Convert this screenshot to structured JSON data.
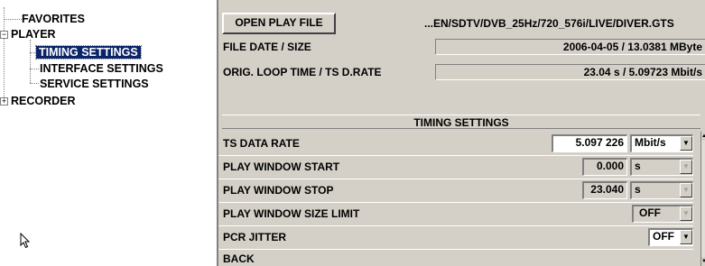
{
  "tree": {
    "items": [
      {
        "label": "FAVORITES"
      },
      {
        "label": "PLAYER",
        "expander": "−"
      },
      {
        "label": "TIMING SETTINGS"
      },
      {
        "label": "INTERFACE SETTINGS"
      },
      {
        "label": "SERVICE SETTINGS"
      },
      {
        "label": "RECORDER",
        "expander": "+"
      }
    ]
  },
  "file_info": {
    "open_button": "OPEN PLAY FILE",
    "path": "...EN/SDTV/DVB_25Hz/720_576i/LIVE/DIVER.GTS",
    "date_size_label": "FILE DATE / SIZE",
    "date_size_value": "2006-04-05  /  13.0381 MByte",
    "loop_label": "ORIG. LOOP TIME / TS D.RATE",
    "loop_value": "23.04 s / 5.09723 Mbit/s"
  },
  "section": {
    "title": "TIMING SETTINGS"
  },
  "settings": {
    "ts_rate": {
      "label": "TS DATA RATE",
      "value": "5.097 226",
      "unit": "Mbit/s"
    },
    "window_start": {
      "label": "PLAY WINDOW START",
      "value": "0.000",
      "unit": "s"
    },
    "window_stop": {
      "label": "PLAY WINDOW STOP",
      "value": "23.040",
      "unit": "s"
    },
    "size_limit": {
      "label": "PLAY WINDOW SIZE LIMIT",
      "value": "OFF"
    },
    "pcr_jitter": {
      "label": "PCR JITTER",
      "value": "OFF"
    },
    "back": {
      "label": "BACK"
    }
  },
  "icons": {
    "dropdown": "▼",
    "scroll_up": "▲",
    "scroll_down": "▼"
  },
  "colors": {
    "panel_bg": "#d4d0c8",
    "selection_bg": "#0a246a"
  }
}
